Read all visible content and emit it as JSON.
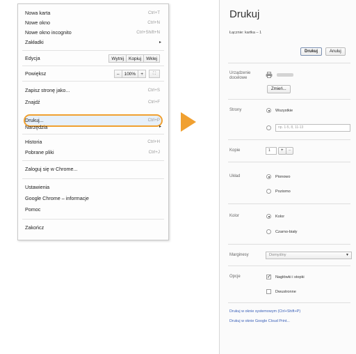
{
  "menu": {
    "items": [
      {
        "label": "Nowa karta",
        "shortcut": "Ctrl+T"
      },
      {
        "label": "Nowe okno",
        "shortcut": "Ctrl+N"
      },
      {
        "label": "Nowe okno incognito",
        "shortcut": "Ctrl+Shift+N"
      },
      {
        "label": "Zakładki",
        "shortcut": ""
      },
      {
        "label": "Edycja",
        "shortcut": ""
      },
      {
        "label": "Powiększ",
        "shortcut": ""
      },
      {
        "label": "Zapisz stronę jako...",
        "shortcut": "Ctrl+S"
      },
      {
        "label": "Znajdź",
        "shortcut": "Ctrl+F"
      },
      {
        "label": "Drukuj...",
        "shortcut": "Ctrl+P"
      },
      {
        "label": "Narzędzia",
        "shortcut": ""
      },
      {
        "label": "Historia",
        "shortcut": "Ctrl+H"
      },
      {
        "label": "Pobrane pliki",
        "shortcut": "Ctrl+J"
      },
      {
        "label": "Zaloguj się w Chrome...",
        "shortcut": ""
      },
      {
        "label": "Ustawienia",
        "shortcut": ""
      },
      {
        "label": "Google Chrome – informacje",
        "shortcut": ""
      },
      {
        "label": "Pomoc",
        "shortcut": ""
      },
      {
        "label": "Zakończ",
        "shortcut": ""
      }
    ],
    "edit_buttons": [
      "Wytnij",
      "Kopiuj",
      "Wklej"
    ],
    "zoom": {
      "minus": "–",
      "value": "100%",
      "plus": "+"
    },
    "submenu_arrow": "▸",
    "highlight_color": "#f0a030"
  },
  "print": {
    "title": "Drukuj",
    "count": "Łącznie: kartka – 1",
    "print_button": "Drukuj",
    "cancel_button": "Anuluj",
    "destination_label": "Urządzenie docelowe",
    "change_button": "Zmień...",
    "pages_label": "Strony",
    "pages_all": "Wszystkie",
    "pages_placeholder": "np. 1-5, 8, 11-13",
    "copies_label": "Kopie",
    "copies_value": "1",
    "copies_plus": "+",
    "copies_minus": "–",
    "layout_label": "Układ",
    "layout_portrait": "Pionowo",
    "layout_landscape": "Poziomo",
    "color_label": "Kolor",
    "color_color": "Kolor",
    "color_bw": "Czarno-biały",
    "margins_label": "Marginesy",
    "margins_value": "Domyślny",
    "options_label": "Opcje",
    "opt_headers": "Nagłówki i stopki",
    "opt_duplex": "Dwustronne",
    "link_system": "Drukuj w oknie systemowym (Ctrl+Shift+P)",
    "link_cloud": "Drukuj w oknie Google Cloud Print...",
    "accent_color": "#3a60b8"
  }
}
